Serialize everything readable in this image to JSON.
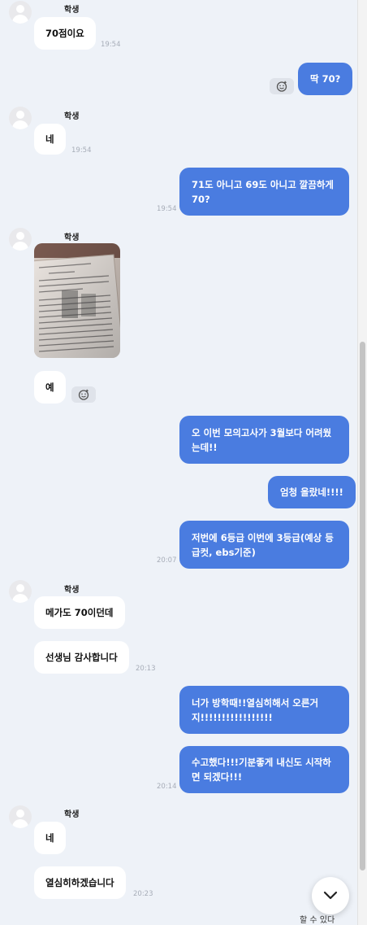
{
  "sender_name": "학생",
  "scroll_down_icon": "chevron-down-icon",
  "reaction_icon": "emoji-add-icon",
  "partial_text": "할 수 있다",
  "messages": [
    {
      "text": "70점이요",
      "time": "19:54"
    },
    {
      "text": "딱 70?"
    },
    {
      "text": "네",
      "time": "19:54"
    },
    {
      "text": "71도 아니고 69도 아니고 깔끔하게 70?",
      "time": "19:54"
    },
    {
      "text": "예"
    },
    {
      "text": "오 이번 모의고사가 3월보다 어려웠는데!!"
    },
    {
      "text": "엄청 올랐네!!!!"
    },
    {
      "text": "저번에 6등급 이번에 3등급(예상 등급컷, ebs기준)",
      "time": "20:07"
    },
    {
      "text": "메가도 70이던데"
    },
    {
      "text": "선생님 감사합니다",
      "time": "20:13"
    },
    {
      "text": "너가 방학때!!열심히해서 오른거지!!!!!!!!!!!!!!!!!"
    },
    {
      "text": "수고했다!!!기분좋게 내신도 시작하면 되겠다!!!",
      "time": "20:14"
    },
    {
      "text": "네"
    },
    {
      "text": "열심히하겠습니다",
      "time": "20:23"
    }
  ],
  "colors": {
    "background": "#eef2f8",
    "outgoing_bubble": "#4a7ce0",
    "incoming_bubble": "#ffffff"
  }
}
